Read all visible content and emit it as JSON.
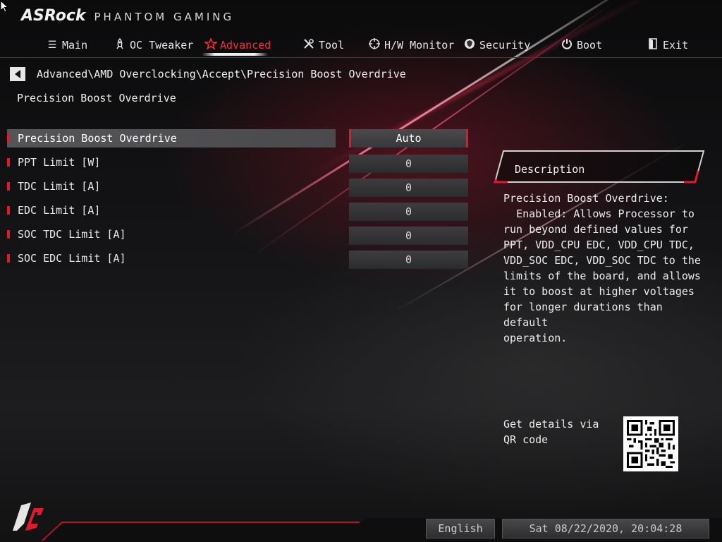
{
  "header": {
    "brand": "ASRock",
    "subtitle": "PHANTOM GAMING"
  },
  "nav": {
    "tabs": [
      {
        "label": "Main",
        "icon": "list-icon"
      },
      {
        "label": "OC Tweaker",
        "icon": "rocket-icon"
      },
      {
        "label": "Advanced",
        "icon": "star-icon",
        "active": true
      },
      {
        "label": "Tool",
        "icon": "tools-icon"
      },
      {
        "label": "H/W Monitor",
        "icon": "crosshair-icon"
      },
      {
        "label": "Security",
        "icon": "shield-icon"
      },
      {
        "label": "Boot",
        "icon": "power-icon"
      },
      {
        "label": "Exit",
        "icon": "exit-door-icon"
      }
    ]
  },
  "breadcrumb": "Advanced\\AMD Overclocking\\Accept\\Precision Boost Overdrive",
  "page_title": "Precision Boost Overdrive",
  "settings": [
    {
      "label": "Precision Boost Overdrive",
      "value": "Auto",
      "selected": true
    },
    {
      "label": "PPT Limit [W]",
      "value": "0"
    },
    {
      "label": "TDC Limit [A]",
      "value": "0"
    },
    {
      "label": "EDC Limit [A]",
      "value": "0"
    },
    {
      "label": "SOC TDC Limit [A]",
      "value": "0"
    },
    {
      "label": "SOC EDC Limit [A]",
      "value": "0"
    }
  ],
  "description": {
    "title": "Description",
    "text": "Precision Boost Overdrive:\n  Enabled: Allows Processor to\nrun beyond defined values for\nPPT, VDD_CPU EDC, VDD_CPU TDC,\nVDD_SOC EDC, VDD_SOC TDC to the\nlimits of the board, and allows\nit to boost at higher voltages\nfor longer durations than default\noperation."
  },
  "qr": {
    "text": "Get details via QR code"
  },
  "footer": {
    "language": "English",
    "datetime": "Sat 08/22/2020, 20:04:28"
  },
  "colors": {
    "accent": "#e01a2c",
    "active_tab": "#ff2a3c"
  }
}
